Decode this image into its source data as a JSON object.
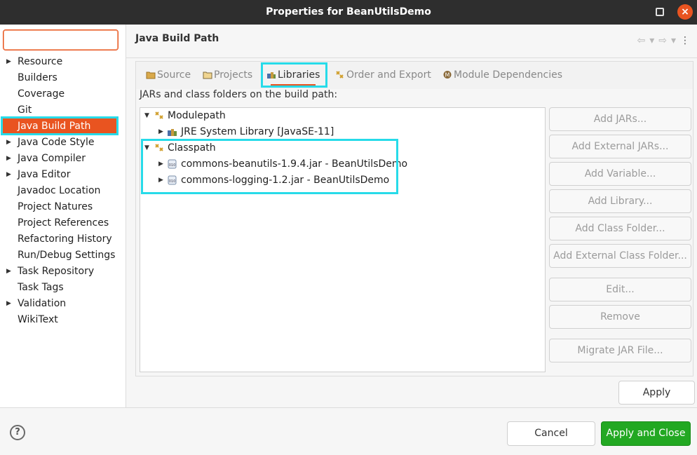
{
  "window": {
    "title": "Properties for BeanUtilsDemo"
  },
  "sidebar": {
    "filter_value": "",
    "items": [
      {
        "label": "Resource",
        "expandable": true
      },
      {
        "label": "Builders",
        "expandable": false
      },
      {
        "label": "Coverage",
        "expandable": false
      },
      {
        "label": "Git",
        "expandable": false
      },
      {
        "label": "Java Build Path",
        "expandable": false,
        "selected": true
      },
      {
        "label": "Java Code Style",
        "expandable": true
      },
      {
        "label": "Java Compiler",
        "expandable": true
      },
      {
        "label": "Java Editor",
        "expandable": true
      },
      {
        "label": "Javadoc Location",
        "expandable": false
      },
      {
        "label": "Project Natures",
        "expandable": false
      },
      {
        "label": "Project References",
        "expandable": false
      },
      {
        "label": "Refactoring History",
        "expandable": false
      },
      {
        "label": "Run/Debug Settings",
        "expandable": false
      },
      {
        "label": "Task Repository",
        "expandable": true
      },
      {
        "label": "Task Tags",
        "expandable": false
      },
      {
        "label": "Validation",
        "expandable": true
      },
      {
        "label": "WikiText",
        "expandable": false
      }
    ]
  },
  "header": {
    "page_title": "Java Build Path"
  },
  "tabs": [
    {
      "label": "Source",
      "icon": "source-folder-icon"
    },
    {
      "label": "Projects",
      "icon": "projects-icon"
    },
    {
      "label": "Libraries",
      "icon": "libraries-icon",
      "active": true
    },
    {
      "label": "Order and Export",
      "icon": "order-export-icon"
    },
    {
      "label": "Module Dependencies",
      "icon": "module-icon"
    }
  ],
  "build_path": {
    "caption": "JARs and class folders on the build path:",
    "modulepath": {
      "label": "Modulepath",
      "children": [
        "JRE System Library [JavaSE-11]"
      ]
    },
    "classpath": {
      "label": "Classpath",
      "children": [
        "commons-beanutils-1.9.4.jar - BeanUtilsDemo",
        "commons-logging-1.2.jar - BeanUtilsDemo"
      ]
    }
  },
  "side_buttons": {
    "add_jars": "Add JARs...",
    "add_external_jars": "Add External JARs...",
    "add_variable": "Add Variable...",
    "add_library": "Add Library...",
    "add_class_folder": "Add Class Folder...",
    "add_external_class_folder": "Add External Class Folder...",
    "edit": "Edit...",
    "remove": "Remove",
    "migrate_jar": "Migrate JAR File..."
  },
  "buttons": {
    "apply": "Apply",
    "cancel": "Cancel",
    "apply_and_close": "Apply and Close",
    "help_glyph": "?"
  },
  "colors": {
    "accent": "#e95420",
    "highlight": "#27dbe9",
    "primary_button": "#22a822"
  }
}
